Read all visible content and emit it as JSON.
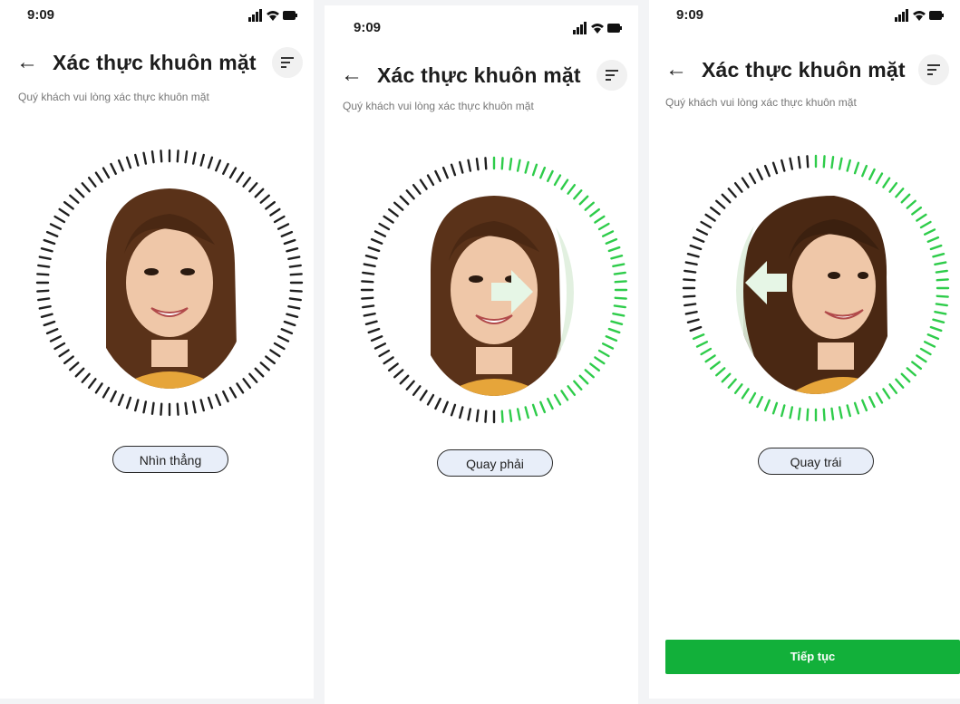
{
  "screens": [
    {
      "status_time": "9:09",
      "title": "Xác thực khuôn mặt",
      "subtitle": "Quý khách vui lòng xác thực khuôn mặt",
      "instruction": "Nhìn thẳng",
      "progress": 0,
      "direction": "straight"
    },
    {
      "status_time": "9:09",
      "title": "Xác thực khuôn mặt",
      "subtitle": "Quý khách vui lòng xác thực khuôn mặt",
      "instruction": "Quay phải",
      "progress": 0.5,
      "direction": "right"
    },
    {
      "status_time": "9:09",
      "title": "Xác thực khuôn mặt",
      "subtitle": "Quý khách vui lòng xác thực khuôn mặt",
      "instruction": "Quay trái",
      "progress": 0.7,
      "direction": "left",
      "continue_label": "Tiếp tục"
    }
  ],
  "colors": {
    "accent_green": "#12b03a",
    "tick_dark": "#1f1f1f",
    "tick_green": "#2ecc4a",
    "pill_bg": "#e8eef9",
    "arrow_fill": "#e6f6e6"
  },
  "icons": {
    "back": "arrow-left-icon",
    "filter": "filter-icon",
    "signal": "signal-icon",
    "wifi": "wifi-icon",
    "battery": "battery-icon"
  }
}
